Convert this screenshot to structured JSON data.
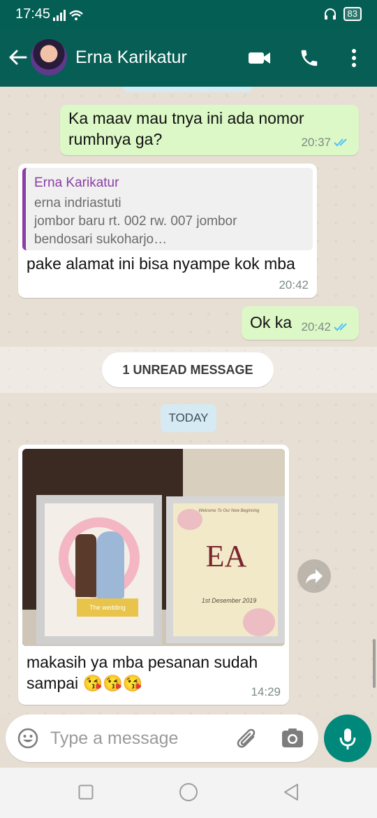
{
  "status_bar": {
    "time": "17:45",
    "battery": "83"
  },
  "header": {
    "contact_name": "Erna Karikatur"
  },
  "messages": {
    "m1": {
      "text": "Ka maav mau tnya ini ada nomor rumhnya ga?",
      "time": "20:37"
    },
    "m2": {
      "quote_name": "Erna Karikatur",
      "quote_text": "erna indriastuti\njombor baru rt. 002 rw. 007 jombor\nbendosari sukoharjo…",
      "text": "pake alamat ini bisa nyampe kok mba",
      "time": "20:42"
    },
    "m3": {
      "text": "Ok ka",
      "time": "20:42"
    },
    "unread_label": "1 UNREAD MESSAGE",
    "date_label": "TODAY",
    "m4": {
      "photo_left_caption": "The wedding",
      "photo_right_welcome": "Welcome To Our New Beginning",
      "photo_right_initials": "EA",
      "photo_right_date": "1st Desember 2019",
      "text": "makasih ya mba pesanan sudah sampai 😘😘😘",
      "time": "14:29"
    }
  },
  "composer": {
    "placeholder": "Type a message"
  },
  "colors": {
    "header": "#075e54",
    "outgoing": "#dcf8c6",
    "accent": "#00897b",
    "ticks": "#4fc3f7"
  }
}
